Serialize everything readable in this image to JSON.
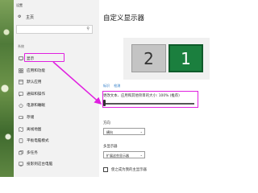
{
  "window": {
    "title": "设置"
  },
  "sidebar": {
    "home_label": "主页",
    "search_placeholder": "",
    "section_label": "系统",
    "items": [
      {
        "label": "显示",
        "icon": "monitor-icon"
      },
      {
        "label": "应用和功能",
        "icon": "apps-icon"
      },
      {
        "label": "默认应用",
        "icon": "default-apps-icon"
      },
      {
        "label": "通知和操作",
        "icon": "notifications-icon"
      },
      {
        "label": "电源和睡眠",
        "icon": "power-icon"
      },
      {
        "label": "存储",
        "icon": "storage-icon"
      },
      {
        "label": "离线地图",
        "icon": "map-icon"
      },
      {
        "label": "平板电脑模式",
        "icon": "tablet-icon"
      },
      {
        "label": "多任务",
        "icon": "multitask-icon"
      },
      {
        "label": "投影到这台电脑",
        "icon": "project-icon"
      }
    ]
  },
  "main": {
    "title": "自定义显示器",
    "monitors": [
      "2",
      "1"
    ],
    "links": [
      "标识",
      "检测"
    ],
    "scale_label": "更改文本、应用和其他项目的大小: 100% (推荐)",
    "scale_value_percent": 100,
    "orientation_label": "方向",
    "orientation_value": "横向",
    "multi_display_label": "多显示器",
    "multi_display_value": "扩展这些显示器",
    "checkbox_label": "使之成为我的主显示器",
    "checkbox_checked": false
  },
  "colors": {
    "accent": "#1b7f3e",
    "highlight": "#e020e0",
    "link": "#1a6fc2"
  }
}
